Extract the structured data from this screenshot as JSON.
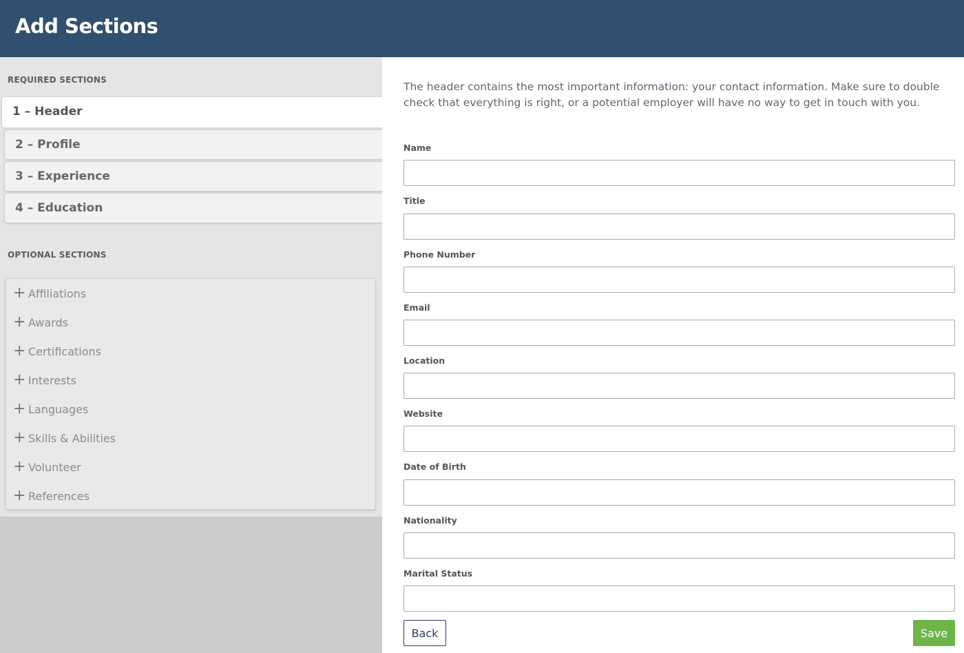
{
  "header": {
    "title": "Add Sections"
  },
  "sidebar": {
    "required_heading": "REQUIRED SECTIONS",
    "required": [
      {
        "label": "1 – Header",
        "active": true
      },
      {
        "label": "2 – Profile",
        "active": false
      },
      {
        "label": "3 – Experience",
        "active": false
      },
      {
        "label": "4 – Education",
        "active": false
      }
    ],
    "optional_heading": "OPTIONAL SECTIONS",
    "optional": [
      {
        "label": "Affiliations",
        "icon": "plus-icon"
      },
      {
        "label": "Awards",
        "icon": "plus-icon"
      },
      {
        "label": "Certifications",
        "icon": "plus-icon"
      },
      {
        "label": "Interests",
        "icon": "plus-icon"
      },
      {
        "label": "Languages",
        "icon": "plus-icon"
      },
      {
        "label": "Skills & Abilities",
        "icon": "plus-icon"
      },
      {
        "label": "Volunteer",
        "icon": "plus-icon"
      },
      {
        "label": "References",
        "icon": "plus-icon"
      }
    ]
  },
  "main": {
    "intro": "The header contains the most important information: your contact information. Make sure to double check that everything is right, or a potential employer will have no way to get in touch with you.",
    "fields": [
      {
        "label": "Name",
        "value": ""
      },
      {
        "label": "Title",
        "value": ""
      },
      {
        "label": "Phone Number",
        "value": ""
      },
      {
        "label": "Email",
        "value": ""
      },
      {
        "label": "Location",
        "value": ""
      },
      {
        "label": "Website",
        "value": ""
      },
      {
        "label": "Date of Birth",
        "value": ""
      },
      {
        "label": "Nationality",
        "value": ""
      },
      {
        "label": "Marital Status",
        "value": ""
      }
    ],
    "back_label": "Back",
    "save_label": "Save"
  },
  "colors": {
    "header_bg": "#31506f",
    "save_bg": "#6eb548",
    "back_border": "#2c3a6e"
  }
}
